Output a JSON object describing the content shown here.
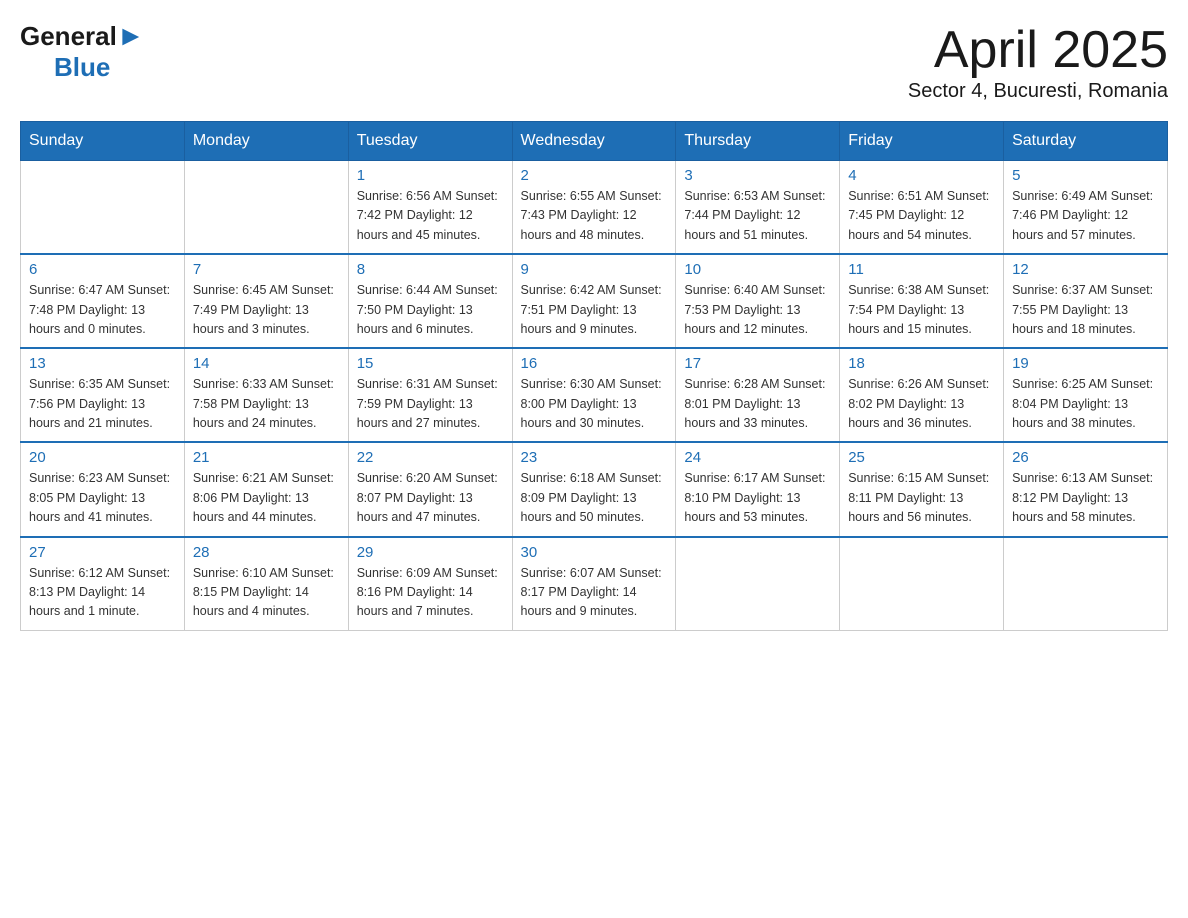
{
  "header": {
    "logo": {
      "general": "General",
      "arrow": "▶",
      "blue": "Blue"
    },
    "title": "April 2025",
    "subtitle": "Sector 4, Bucuresti, Romania"
  },
  "days_of_week": [
    "Sunday",
    "Monday",
    "Tuesday",
    "Wednesday",
    "Thursday",
    "Friday",
    "Saturday"
  ],
  "weeks": [
    [
      {
        "day": "",
        "info": ""
      },
      {
        "day": "",
        "info": ""
      },
      {
        "day": "1",
        "info": "Sunrise: 6:56 AM\nSunset: 7:42 PM\nDaylight: 12 hours\nand 45 minutes."
      },
      {
        "day": "2",
        "info": "Sunrise: 6:55 AM\nSunset: 7:43 PM\nDaylight: 12 hours\nand 48 minutes."
      },
      {
        "day": "3",
        "info": "Sunrise: 6:53 AM\nSunset: 7:44 PM\nDaylight: 12 hours\nand 51 minutes."
      },
      {
        "day": "4",
        "info": "Sunrise: 6:51 AM\nSunset: 7:45 PM\nDaylight: 12 hours\nand 54 minutes."
      },
      {
        "day": "5",
        "info": "Sunrise: 6:49 AM\nSunset: 7:46 PM\nDaylight: 12 hours\nand 57 minutes."
      }
    ],
    [
      {
        "day": "6",
        "info": "Sunrise: 6:47 AM\nSunset: 7:48 PM\nDaylight: 13 hours\nand 0 minutes."
      },
      {
        "day": "7",
        "info": "Sunrise: 6:45 AM\nSunset: 7:49 PM\nDaylight: 13 hours\nand 3 minutes."
      },
      {
        "day": "8",
        "info": "Sunrise: 6:44 AM\nSunset: 7:50 PM\nDaylight: 13 hours\nand 6 minutes."
      },
      {
        "day": "9",
        "info": "Sunrise: 6:42 AM\nSunset: 7:51 PM\nDaylight: 13 hours\nand 9 minutes."
      },
      {
        "day": "10",
        "info": "Sunrise: 6:40 AM\nSunset: 7:53 PM\nDaylight: 13 hours\nand 12 minutes."
      },
      {
        "day": "11",
        "info": "Sunrise: 6:38 AM\nSunset: 7:54 PM\nDaylight: 13 hours\nand 15 minutes."
      },
      {
        "day": "12",
        "info": "Sunrise: 6:37 AM\nSunset: 7:55 PM\nDaylight: 13 hours\nand 18 minutes."
      }
    ],
    [
      {
        "day": "13",
        "info": "Sunrise: 6:35 AM\nSunset: 7:56 PM\nDaylight: 13 hours\nand 21 minutes."
      },
      {
        "day": "14",
        "info": "Sunrise: 6:33 AM\nSunset: 7:58 PM\nDaylight: 13 hours\nand 24 minutes."
      },
      {
        "day": "15",
        "info": "Sunrise: 6:31 AM\nSunset: 7:59 PM\nDaylight: 13 hours\nand 27 minutes."
      },
      {
        "day": "16",
        "info": "Sunrise: 6:30 AM\nSunset: 8:00 PM\nDaylight: 13 hours\nand 30 minutes."
      },
      {
        "day": "17",
        "info": "Sunrise: 6:28 AM\nSunset: 8:01 PM\nDaylight: 13 hours\nand 33 minutes."
      },
      {
        "day": "18",
        "info": "Sunrise: 6:26 AM\nSunset: 8:02 PM\nDaylight: 13 hours\nand 36 minutes."
      },
      {
        "day": "19",
        "info": "Sunrise: 6:25 AM\nSunset: 8:04 PM\nDaylight: 13 hours\nand 38 minutes."
      }
    ],
    [
      {
        "day": "20",
        "info": "Sunrise: 6:23 AM\nSunset: 8:05 PM\nDaylight: 13 hours\nand 41 minutes."
      },
      {
        "day": "21",
        "info": "Sunrise: 6:21 AM\nSunset: 8:06 PM\nDaylight: 13 hours\nand 44 minutes."
      },
      {
        "day": "22",
        "info": "Sunrise: 6:20 AM\nSunset: 8:07 PM\nDaylight: 13 hours\nand 47 minutes."
      },
      {
        "day": "23",
        "info": "Sunrise: 6:18 AM\nSunset: 8:09 PM\nDaylight: 13 hours\nand 50 minutes."
      },
      {
        "day": "24",
        "info": "Sunrise: 6:17 AM\nSunset: 8:10 PM\nDaylight: 13 hours\nand 53 minutes."
      },
      {
        "day": "25",
        "info": "Sunrise: 6:15 AM\nSunset: 8:11 PM\nDaylight: 13 hours\nand 56 minutes."
      },
      {
        "day": "26",
        "info": "Sunrise: 6:13 AM\nSunset: 8:12 PM\nDaylight: 13 hours\nand 58 minutes."
      }
    ],
    [
      {
        "day": "27",
        "info": "Sunrise: 6:12 AM\nSunset: 8:13 PM\nDaylight: 14 hours\nand 1 minute."
      },
      {
        "day": "28",
        "info": "Sunrise: 6:10 AM\nSunset: 8:15 PM\nDaylight: 14 hours\nand 4 minutes."
      },
      {
        "day": "29",
        "info": "Sunrise: 6:09 AM\nSunset: 8:16 PM\nDaylight: 14 hours\nand 7 minutes."
      },
      {
        "day": "30",
        "info": "Sunrise: 6:07 AM\nSunset: 8:17 PM\nDaylight: 14 hours\nand 9 minutes."
      },
      {
        "day": "",
        "info": ""
      },
      {
        "day": "",
        "info": ""
      },
      {
        "day": "",
        "info": ""
      }
    ]
  ]
}
